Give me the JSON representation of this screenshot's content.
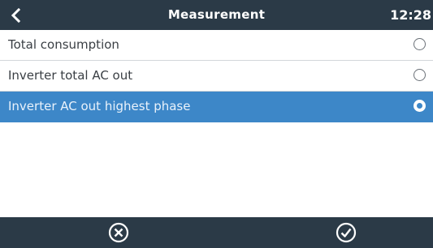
{
  "header": {
    "back_icon": "chevron-left-icon",
    "title": "Measurement",
    "clock": "12:28"
  },
  "options": [
    {
      "label": "Total consumption",
      "selected": false
    },
    {
      "label": "Inverter total AC out",
      "selected": false
    },
    {
      "label": "Inverter AC out highest phase",
      "selected": true
    }
  ],
  "footer": {
    "cancel_icon": "cancel-circle-icon",
    "confirm_icon": "check-circle-icon"
  },
  "colors": {
    "bar": "#2b3a47",
    "selection": "#3d87c8",
    "background": "#ffffff"
  }
}
